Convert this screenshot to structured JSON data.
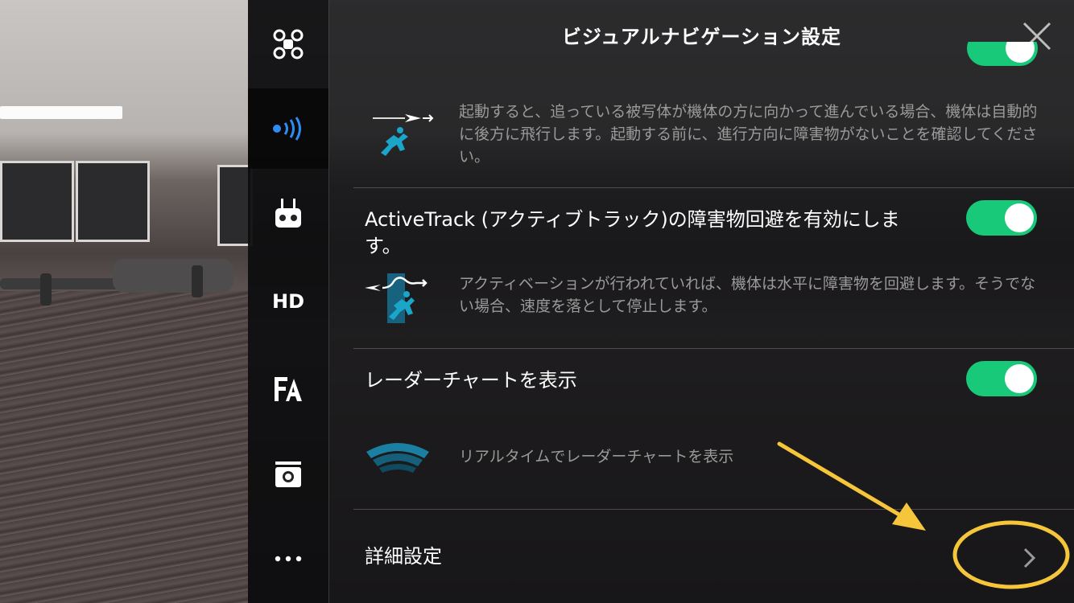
{
  "header": {
    "title": "ビジュアルナビゲーション設定",
    "close_icon": "close-icon"
  },
  "sidebar": {
    "items": [
      {
        "icon": "drone-icon",
        "active": false
      },
      {
        "icon": "signal-icon",
        "active": true
      },
      {
        "icon": "remote-controller-icon",
        "active": false
      },
      {
        "label": "HD",
        "icon": "hd-icon",
        "active": false
      },
      {
        "icon": "fa-text-icon",
        "active": false
      },
      {
        "icon": "camera-icon",
        "active": false
      },
      {
        "icon": "more-icon",
        "active": false
      }
    ]
  },
  "settings": {
    "backward_flight_desc": "起動すると、追っている被写体が機体の方に向かって進んでいる場合、機体は自動的に後方に飛行します。起動する前に、進行方向に障害物がないことを確認してください。",
    "activetrack": {
      "label": "ActiveTrack (アクティブトラック)の障害物回避を有効にします。",
      "enabled": true,
      "desc": "アクティベーションが行われていれば、機体は水平に障害物を回避します。そうでない場合、速度を落として停止します。"
    },
    "radar": {
      "label": "レーダーチャートを表示",
      "enabled": true,
      "desc": "リアルタイムでレーダーチャートを表示"
    },
    "advanced": {
      "label": "詳細設定",
      "chevron_icon": "chevron-right-icon"
    }
  },
  "colors": {
    "accent_green": "#18c97a",
    "signal_blue": "#2f8cf4",
    "annotation_yellow": "#f5c53a"
  }
}
